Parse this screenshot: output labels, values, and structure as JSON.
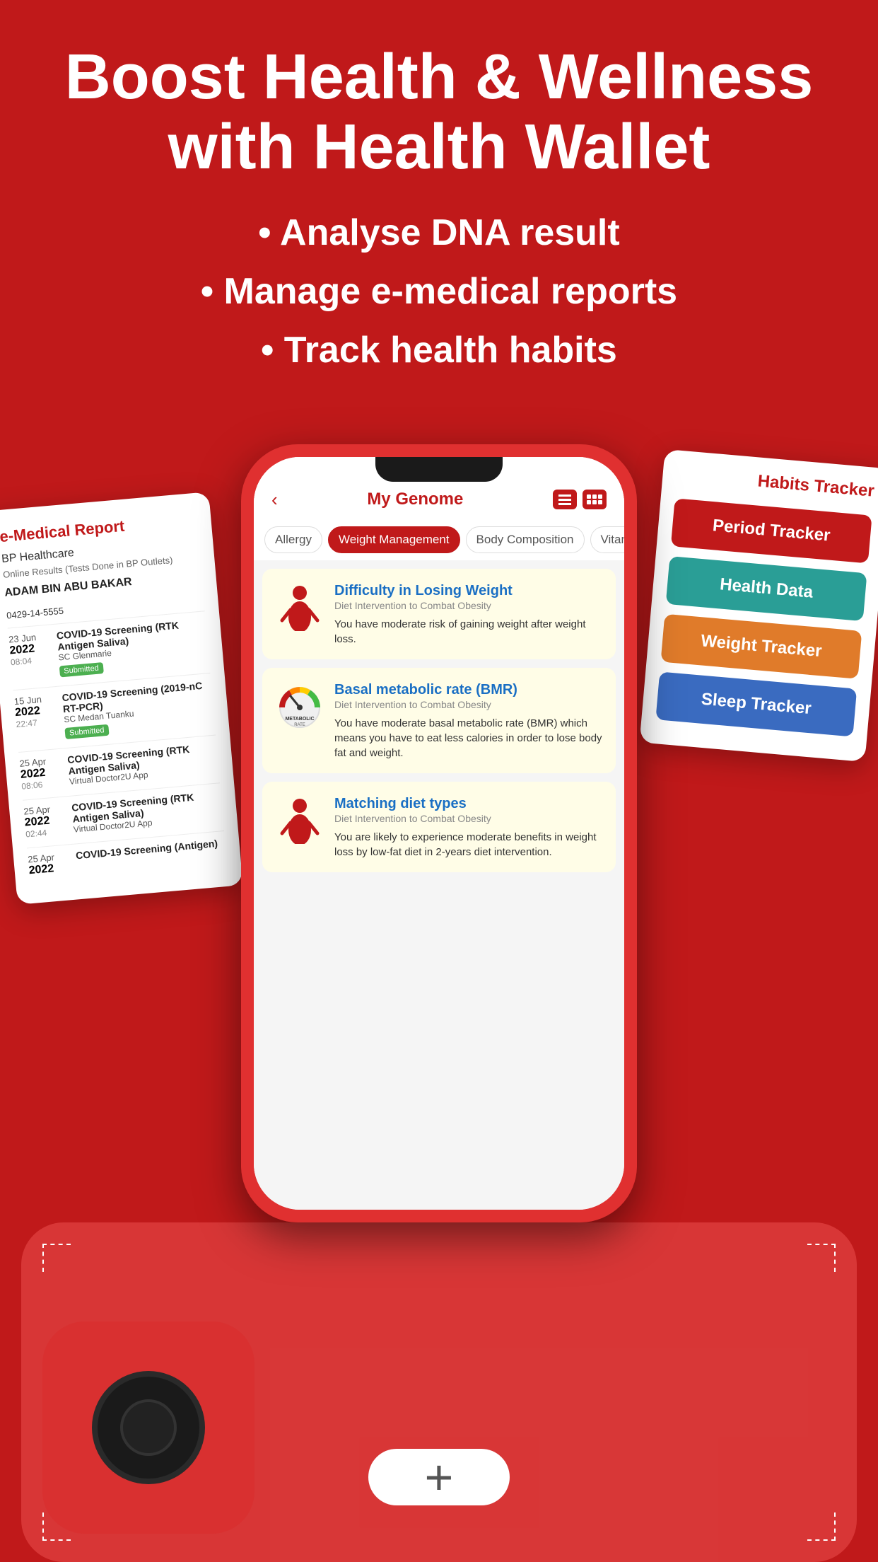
{
  "header": {
    "title_line1": "Boost Health & Wellness",
    "title_line2": "with Health Wallet",
    "bullet1": "• Analyse DNA result",
    "bullet2": "• Manage e-medical reports",
    "bullet3": "• Track health habits"
  },
  "phone": {
    "back_icon": "‹",
    "title": "My Genome",
    "filter_tabs": [
      "Allergy",
      "Weight Management",
      "Body Composition",
      "Vitami..."
    ],
    "active_tab": "Weight Management",
    "cards": [
      {
        "title": "Difficulty in Losing Weight",
        "subtitle": "Diet Intervention to Combat Obesity",
        "body": "You have moderate risk of gaining weight after weight loss.",
        "icon_type": "person"
      },
      {
        "title": "Basal metabolic rate (BMR)",
        "subtitle": "Diet Intervention to Combat Obesity",
        "body": "You have moderate basal metabolic rate (BMR) which means you have to eat less calories in order to lose body fat and weight.",
        "icon_type": "bmr"
      },
      {
        "title": "Matching diet types",
        "subtitle": "Diet Intervention to Combat Obesity",
        "body": "You are likely to experience moderate benefits in weight loss by low-fat diet in 2-years diet intervention.",
        "icon_type": "person"
      }
    ]
  },
  "emedical": {
    "title": "e-Medical Report",
    "provider": "BP Healthcare",
    "provider_sub": "Online Results (Tests Done in BP Outlets)",
    "name": "ADAM BIN ABU BAKAR",
    "phone": "0429-14-5555",
    "records": [
      {
        "day": "23 Jun",
        "year": "2022",
        "time": "08:04",
        "test": "COVID-19 Screening (RTK Antigen Saliva)",
        "location": "SC Glenmarie",
        "status": "Submitted"
      },
      {
        "day": "15 Jun",
        "year": "2022",
        "time": "22:47",
        "test": "COVID-19 Screening (2019-nC RT-PCR)",
        "location": "SC Medan Tuanku",
        "status": "Submitted"
      },
      {
        "day": "25 Apr",
        "year": "2022",
        "time": "08:06",
        "test": "COVID-19 Screening (RTK Antigen Saliva)",
        "location": "Virtual Doctor2U App",
        "status": ""
      },
      {
        "day": "25 Apr",
        "year": "2022",
        "time": "02:44",
        "test": "COVID-19 Screening (RTK Antigen Saliva)",
        "location": "Virtual Doctor2U App",
        "status": ""
      },
      {
        "day": "25 Apr",
        "year": "2022",
        "time": "",
        "test": "COVID-19 Screening (Antigen)",
        "location": "",
        "status": ""
      }
    ]
  },
  "habits": {
    "title": "Habits Tracker",
    "trackers": [
      {
        "label": "Period Tracker",
        "color_class": "tracker-period"
      },
      {
        "label": "Health Data",
        "color_class": "tracker-health"
      },
      {
        "label": "Weight Tracker",
        "color_class": "tracker-weight"
      },
      {
        "label": "Sleep Tracker",
        "color_class": "tracker-sleep"
      }
    ]
  },
  "bottom": {
    "plus_label": "+"
  },
  "colors": {
    "primary": "#c0191a",
    "accent_blue": "#1a6fc4",
    "teal": "#2a9e96",
    "orange": "#e07b2a",
    "blue": "#3a6bc0"
  }
}
